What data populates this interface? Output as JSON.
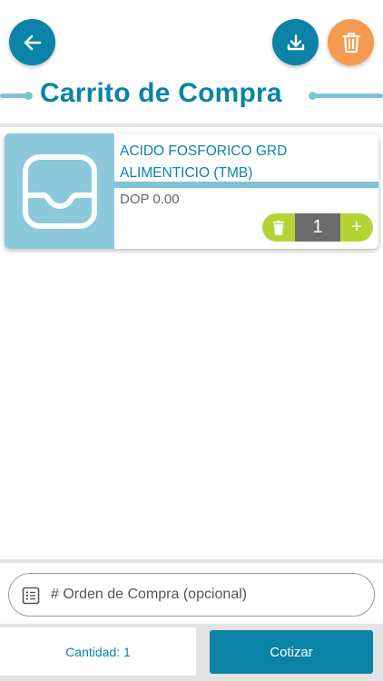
{
  "header": {
    "title": "Carrito de Compra",
    "back_icon": "arrow-left-icon",
    "download_icon": "download-icon",
    "clear_cart_icon": "trash-icon"
  },
  "colors": {
    "primary": "#0b83a6",
    "accent": "#f59a4e",
    "qty_green": "#b5d334",
    "light_blue": "#7fc2d6"
  },
  "cart": {
    "items": [
      {
        "name": "ACIDO FOSFORICO GRD ALIMENTICIO (TMB)",
        "price": "DOP 0.00",
        "quantity": "1",
        "add_label": "+",
        "image_icon": "inbox-tray-icon",
        "delete_icon": "trash-icon"
      }
    ]
  },
  "purchase_order": {
    "placeholder": "# Orden de Compra (opcional)",
    "value": "",
    "icon": "list-icon"
  },
  "footer": {
    "quantity_label": "Cantidad: 1",
    "quote_button": "Cotizar"
  }
}
